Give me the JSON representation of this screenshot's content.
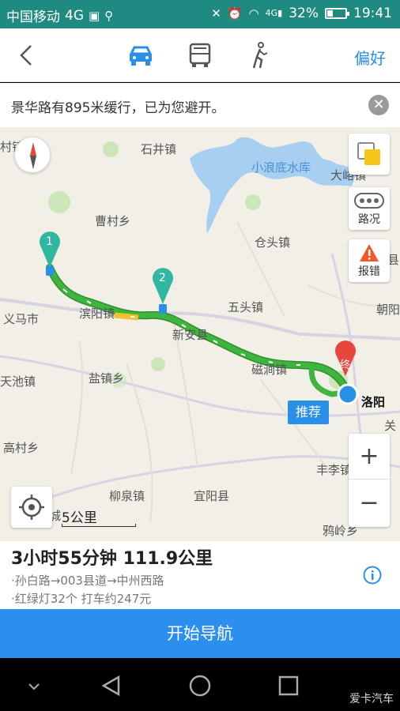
{
  "status_bar": {
    "carrier": "中国移动",
    "network": "4G",
    "signal_label": "4G",
    "battery_percent": "32%",
    "battery_level": 0.32,
    "time": "19:41"
  },
  "top_nav": {
    "modes": [
      "car-icon",
      "bus-icon",
      "walk-icon"
    ],
    "selected_mode": "car",
    "preference_label": "偏好"
  },
  "notice": {
    "text": "景华路有895米缓行，已为您避开。"
  },
  "map": {
    "places": [
      {
        "id": "shijing",
        "label": "石井镇"
      },
      {
        "id": "xiaolangdi",
        "label": "小浪底水库"
      },
      {
        "id": "dayu",
        "label": "大峪镇"
      },
      {
        "id": "caocun",
        "label": "曹村乡"
      },
      {
        "id": "cangtou",
        "label": "仓头镇"
      },
      {
        "id": "wutou",
        "label": "五头镇"
      },
      {
        "id": "binyang",
        "label": "滨阳镇"
      },
      {
        "id": "xinan",
        "label": "新安县"
      },
      {
        "id": "yima",
        "label": "义马市"
      },
      {
        "id": "cijian",
        "label": "磁涧镇"
      },
      {
        "id": "luoyang",
        "label": "洛阳"
      },
      {
        "id": "yanzhen",
        "label": "盐镇乡"
      },
      {
        "id": "tianchi",
        "label": "天池镇"
      },
      {
        "id": "gaocun",
        "label": "高村乡"
      },
      {
        "id": "fengli",
        "label": "丰李镇"
      },
      {
        "id": "liuquan",
        "label": "柳泉镇"
      },
      {
        "id": "yiyang",
        "label": "宜阳县"
      },
      {
        "id": "yaling",
        "label": "鸦岭乡"
      },
      {
        "id": "chaoyang",
        "label": "朝阳"
      },
      {
        "id": "cun",
        "label": "村镇"
      },
      {
        "id": "xian",
        "label": "县"
      },
      {
        "id": "guan",
        "label": "关"
      },
      {
        "id": "cheng",
        "label": "城"
      }
    ],
    "waypoint_labels": [
      "1",
      "2"
    ],
    "destination_label": "终",
    "traffic_label": "路况",
    "report_label": "报错",
    "recommend_label": "推荐",
    "scale_label": "5公里",
    "zoom_in": "+",
    "zoom_out": "−"
  },
  "route": {
    "summary": "3小时55分钟  111.9公里",
    "roads": "·孙白路→003县道→中州西路",
    "extras": "·红绿灯32个  打车约247元"
  },
  "start_button": "开始导航",
  "watermark": "爱卡汽车",
  "colors": {
    "status_bar": "#1f8a7f",
    "accent": "#2a8fe6",
    "route_fast": "#3fb53f",
    "route_slow": "#f2c12e",
    "waypoint": "#2fb7a0",
    "destination": "#e8453c",
    "water": "#a7cff0"
  }
}
